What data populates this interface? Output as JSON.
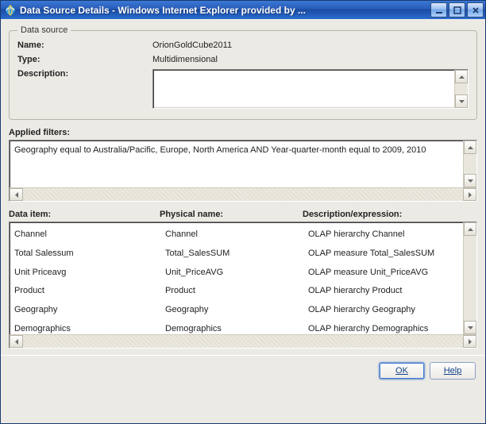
{
  "window": {
    "title": "Data Source Details - Windows Internet Explorer provided by ..."
  },
  "groupbox": {
    "legend": "Data source",
    "name_label": "Name:",
    "name_value": "OrionGoldCube2011",
    "type_label": "Type:",
    "type_value": "Multidimensional",
    "description_label": "Description:",
    "description_value": ""
  },
  "filters": {
    "label": "Applied filters:",
    "text": "Geography equal to Australia/Pacific, Europe, North America AND Year-quarter-month equal to 2009, 2010"
  },
  "grid": {
    "headers": {
      "col1": "Data item:",
      "col2": "Physical name:",
      "col3": "Description/expression:"
    },
    "rows": [
      {
        "item": "Channel",
        "phys": "Channel",
        "desc": "OLAP hierarchy Channel"
      },
      {
        "item": "Total Salessum",
        "phys": "Total_SalesSUM",
        "desc": "OLAP measure Total_SalesSUM"
      },
      {
        "item": "Unit Priceavg",
        "phys": "Unit_PriceAVG",
        "desc": "OLAP measure Unit_PriceAVG"
      },
      {
        "item": "Product",
        "phys": "Product",
        "desc": "OLAP hierarchy Product"
      },
      {
        "item": "Geography",
        "phys": "Geography",
        "desc": "OLAP hierarchy Geography"
      },
      {
        "item": "Demographics",
        "phys": "Demographics",
        "desc": "OLAP hierarchy Demographics"
      }
    ]
  },
  "buttons": {
    "ok": "OK",
    "help": "Help"
  }
}
